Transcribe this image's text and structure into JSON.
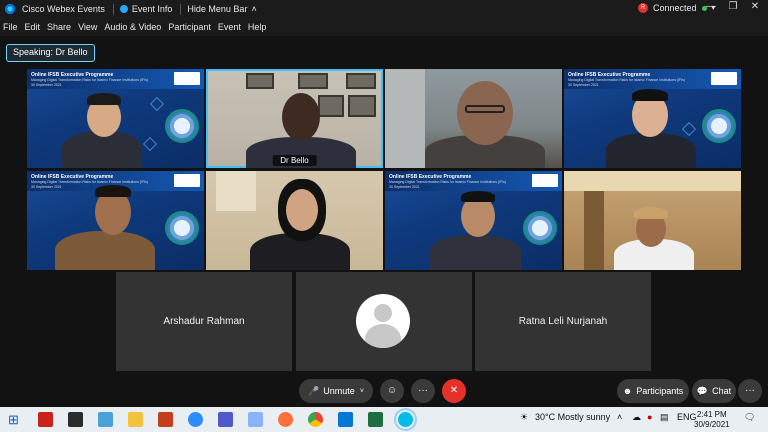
{
  "titlebar": {
    "app_name": "Cisco Webex Events",
    "event_info": "Event Info",
    "hide_menu": "Hide Menu Bar",
    "status": "Connected",
    "rec_letter": "R"
  },
  "menu": [
    "File",
    "Edit",
    "Share",
    "View",
    "Audio & Video",
    "Participant",
    "Event",
    "Help"
  ],
  "speaking": "Speaking: Dr Bello",
  "slide": {
    "title": "Online IFSB Executive Programme",
    "subtitle": "Managing Digital Transformation Risks for Islamic Finance Institutions (IFIs)",
    "date": "30 September 2021"
  },
  "active_speaker_name": "Dr Bello",
  "participants": [
    "Arshadur Rahman",
    "Ratna Leli Nurjanah"
  ],
  "controls": {
    "unmute": "Unmute",
    "participants": "Participants",
    "chat": "Chat",
    "more": "···"
  },
  "taskbar": {
    "weather": "30°C  Mostly sunny",
    "lang": "ENG",
    "time": "2:41 PM",
    "date": "30/9/2021"
  },
  "colors": {
    "accent": "#3fc0ff",
    "end_call": "#e5312a",
    "bg": "#121212"
  }
}
